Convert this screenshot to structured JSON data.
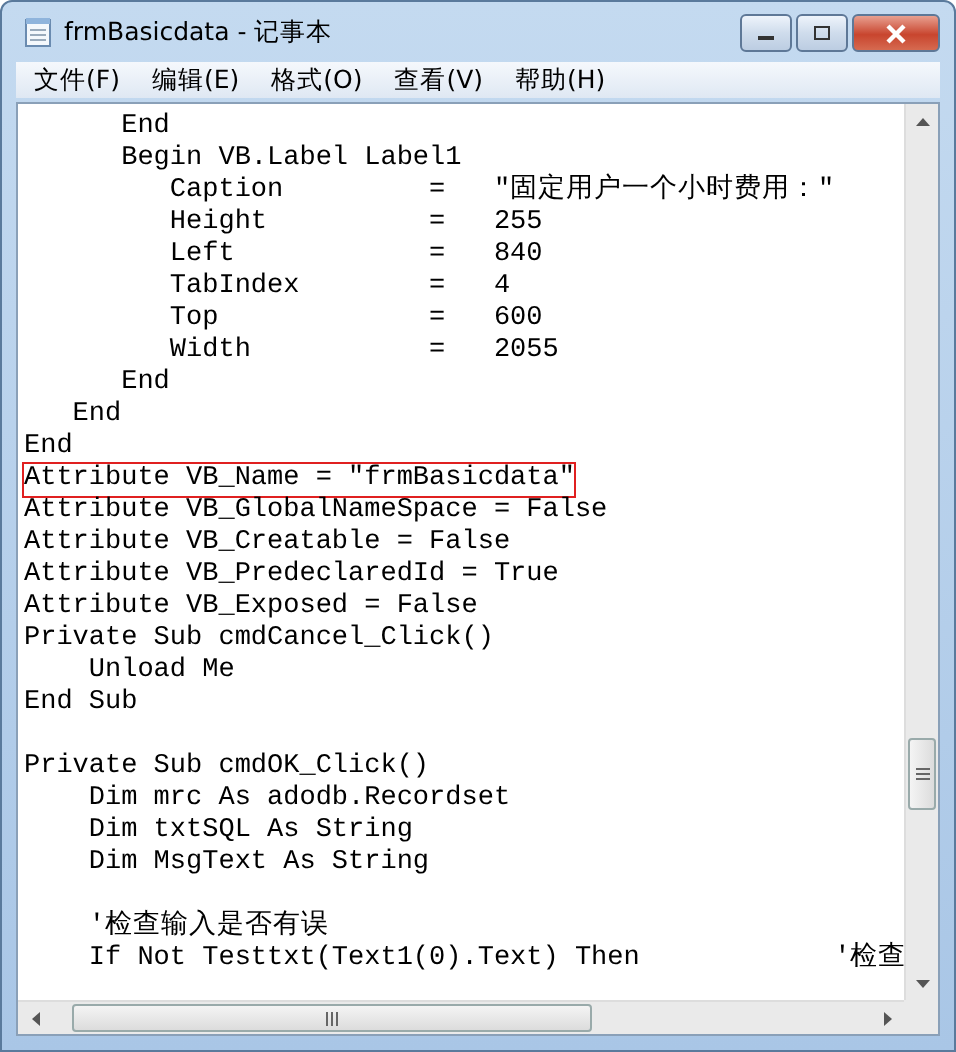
{
  "window": {
    "title": "frmBasicdata - 记事本"
  },
  "menu": [
    "文件(F)",
    "编辑(E)",
    "格式(O)",
    "查看(V)",
    "帮助(H)"
  ],
  "lines": [
    {
      "kind": "code",
      "text": "      End",
      "highlighted": false
    },
    {
      "kind": "code",
      "text": "      Begin VB.Label Label1",
      "highlighted": false
    },
    {
      "kind": "code",
      "text": "         Caption         =   \"固定用户一个小时费用：\"",
      "highlighted": false
    },
    {
      "kind": "code",
      "text": "         Height          =   255",
      "highlighted": false
    },
    {
      "kind": "code",
      "text": "         Left            =   840",
      "highlighted": false
    },
    {
      "kind": "code",
      "text": "         TabIndex        =   4",
      "highlighted": false
    },
    {
      "kind": "code",
      "text": "         Top             =   600",
      "highlighted": false
    },
    {
      "kind": "code",
      "text": "         Width           =   2055",
      "highlighted": false
    },
    {
      "kind": "code",
      "text": "      End",
      "highlighted": false
    },
    {
      "kind": "code",
      "text": "   End",
      "highlighted": false
    },
    {
      "kind": "code",
      "text": "End",
      "highlighted": false
    },
    {
      "kind": "code",
      "text": "Attribute VB_Name = \"frmBasicdata\"",
      "highlighted": true
    },
    {
      "kind": "code",
      "text": "Attribute VB_GlobalNameSpace = False",
      "highlighted": false
    },
    {
      "kind": "code",
      "text": "Attribute VB_Creatable = False",
      "highlighted": false
    },
    {
      "kind": "code",
      "text": "Attribute VB_PredeclaredId = True",
      "highlighted": false
    },
    {
      "kind": "code",
      "text": "Attribute VB_Exposed = False",
      "highlighted": false
    },
    {
      "kind": "code",
      "text": "Private Sub cmdCancel_Click()",
      "highlighted": false
    },
    {
      "kind": "code",
      "text": "    Unload Me",
      "highlighted": false
    },
    {
      "kind": "code",
      "text": "End Sub",
      "highlighted": false
    },
    {
      "kind": "blank"
    },
    {
      "kind": "code",
      "text": "Private Sub cmdOK_Click()",
      "highlighted": false
    },
    {
      "kind": "code",
      "text": "    Dim mrc As adodb.Recordset",
      "highlighted": false
    },
    {
      "kind": "code",
      "text": "    Dim txtSQL As String",
      "highlighted": false
    },
    {
      "kind": "code",
      "text": "    Dim MsgText As String",
      "highlighted": false
    },
    {
      "kind": "blank"
    },
    {
      "kind": "code",
      "text": "    '检查输入是否有误",
      "highlighted": false
    },
    {
      "kind": "code",
      "text": "    If Not Testtxt(Text1(0).Text) Then            '检查",
      "highlighted": false
    }
  ]
}
